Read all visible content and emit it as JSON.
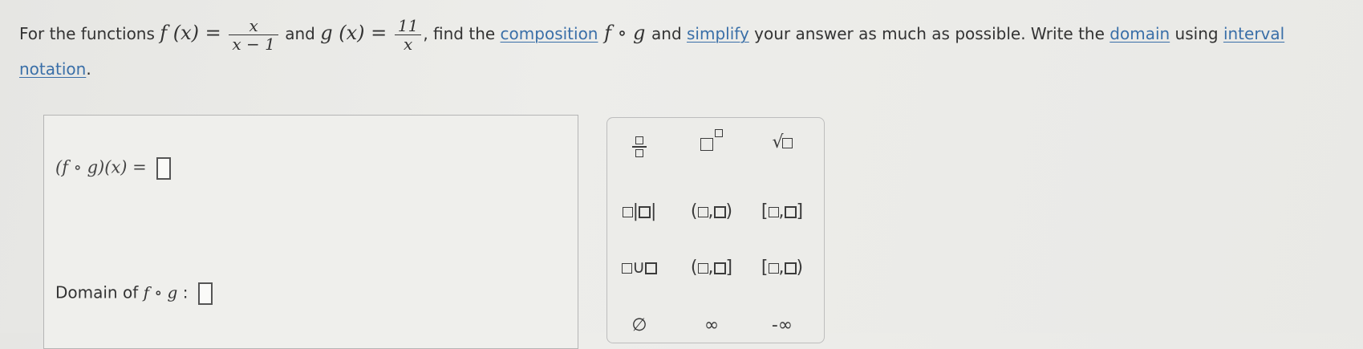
{
  "question": {
    "t1": "For the functions ",
    "f_lhs": "f (x) = ",
    "f_num": "x",
    "f_den": "x − 1",
    "t2": " and ",
    "g_lhs": "g (x) = ",
    "g_num": "11",
    "g_den": "x",
    "t3": ", find the ",
    "link_composition": "composition",
    "fog": " f ∘ g ",
    "t4": " and ",
    "link_simplify": "simplify",
    "t5": " your answer as much as possible. Write the ",
    "link_domain": "domain",
    "t6": " using ",
    "link_interval": "interval",
    "link_notation": "notation",
    "t7": "."
  },
  "answer": {
    "expression": "(f ∘ g)(x) =",
    "domain_label": "Domain of ",
    "domain_fog": "f ∘ g",
    "domain_colon": " :"
  },
  "palette": {
    "empty_set": "∅",
    "infinity": "∞",
    "neg_infinity": "-∞",
    "comma": ",",
    "open_paren": "(",
    "close_paren": ")",
    "open_bracket": "[",
    "close_bracket": "]",
    "union": "∪",
    "bar": "|",
    "sqrt": "√"
  }
}
